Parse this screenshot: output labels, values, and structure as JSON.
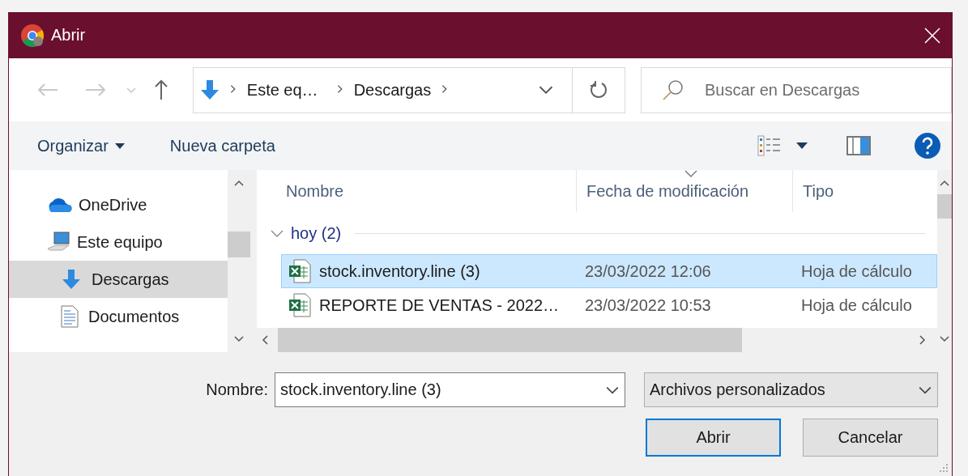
{
  "window": {
    "title": "Abrir"
  },
  "address": {
    "crumbs": [
      "Este eq…",
      "Descargas"
    ]
  },
  "search": {
    "placeholder": "Buscar en Descargas"
  },
  "commands": [
    {
      "label": "Organizar",
      "menu": true
    },
    {
      "label": "Nueva carpeta",
      "menu": false
    }
  ],
  "sidebar": {
    "items": [
      {
        "label": "OneDrive",
        "kind": "cloud",
        "selected": false
      },
      {
        "label": "Este equipo",
        "kind": "computer",
        "selected": false,
        "children": [
          {
            "label": "Descargas",
            "kind": "download",
            "selected": true
          },
          {
            "label": "Documentos",
            "kind": "document",
            "selected": false
          }
        ]
      }
    ]
  },
  "table": {
    "columns": [
      {
        "label": "Nombre",
        "sorted": false
      },
      {
        "label": "Fecha de modificación",
        "sorted": true
      },
      {
        "label": "Tipo",
        "sorted": false
      }
    ],
    "group": {
      "label": "hoy (2)",
      "expanded": true
    },
    "rows": [
      {
        "name": "stock.inventory.line (3)",
        "date": "23/03/2022 12:06",
        "type": "Hoja de cálculo",
        "selected": true
      },
      {
        "name": "REPORTE DE VENTAS - 2022…",
        "date": "23/03/2022 10:53",
        "type": "Hoja de cálculo",
        "selected": false
      }
    ]
  },
  "filename": {
    "label": "Nombre:",
    "value": "stock.inventory.line (3)"
  },
  "filetype": {
    "value": "Archivos personalizados"
  },
  "buttons": [
    {
      "label": "Abrir",
      "default": true
    },
    {
      "label": "Cancelar",
      "default": false
    }
  ]
}
